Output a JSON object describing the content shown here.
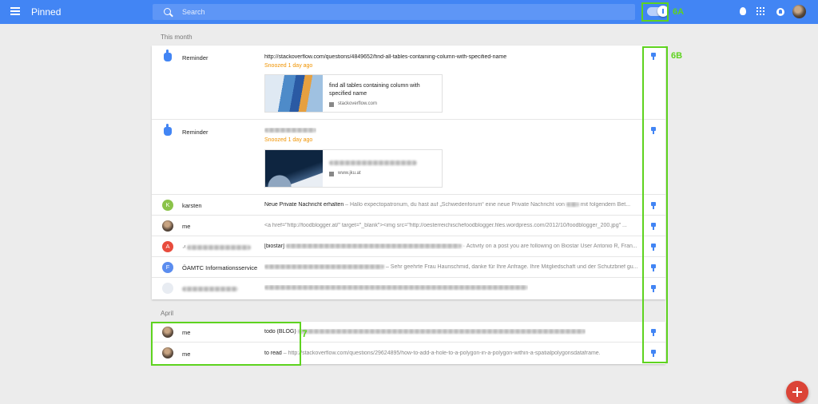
{
  "header": {
    "title": "Pinned",
    "search_placeholder": "Search"
  },
  "annotations": {
    "toggle": "6A",
    "pins": "6B",
    "april": "7"
  },
  "sections": [
    {
      "label": "This month",
      "rows": [
        {
          "sender": "Reminder",
          "subject": "http://stackoverflow.com/questions/4849652/find-all-tables-containing-column-with-specified-name",
          "status": "Snoozed 1 day ago",
          "link_title": "find all tables containing column with specified name",
          "link_domain": "stackoverflow.com"
        },
        {
          "sender": "Reminder",
          "subject": "",
          "status": "Snoozed 1 day ago",
          "link_domain": "www.jku.at"
        },
        {
          "avatar": "K",
          "sender": "karsten",
          "subject": "Neue Private Nachricht erhalten",
          "snippet_a": " – Hallo expectopatronum, du hast auf „Schwedenforum“ eine neue Private Nachricht von",
          "snippet_b": " mit folgendem Bet..."
        },
        {
          "sender": "me",
          "subject": "",
          "snippet_a": "<a href=\"http://foodblogger.at/\" target=\"_blank\"><img src=\"http://oesterreichischefoodblogger.files.wordpress.com/2012/10/foodblogger_200.jpg\" ..."
        },
        {
          "avatar": "A",
          "sender": "·ʳ",
          "subject": "[biostar]",
          "snippet_a": " · Activity on a post you are following on Biostar User Antonio R, Fran..."
        },
        {
          "avatar": "F",
          "sender": "ÖAMTC Informationsservice",
          "subject": "",
          "snippet_a": " – Sehr geehrte Frau Haunschmid, danke für Ihre Anfrage. Ihre Mitgliedschaft und der Schutzbrief gu..."
        },
        {
          "sender": "",
          "subject": "",
          "snippet_a": ""
        }
      ]
    },
    {
      "label": "April",
      "rows": [
        {
          "sender": "me",
          "subject": "todo (BLOG)",
          "snippet_a": ""
        },
        {
          "sender": "me",
          "subject": "to read",
          "snippet_a": " – http://stackoverflow.com/questions/29624895/how-to-add-a-hole-to-a-polygon-in-a-polygon-within-a-spatialpolygonsdataframe."
        }
      ]
    }
  ],
  "icons": [
    "menu-icon",
    "search-icon",
    "pin-toggle-icon",
    "reminder-icon",
    "pin-icon",
    "doc-icon",
    "bulb-icon",
    "apps-grid-icon",
    "notifications-icon",
    "compose-plus-icon"
  ],
  "colors": {
    "header": "#4285f4",
    "snoozed": "#f09300",
    "annotation": "#5ed31f",
    "fab": "#db4437"
  }
}
